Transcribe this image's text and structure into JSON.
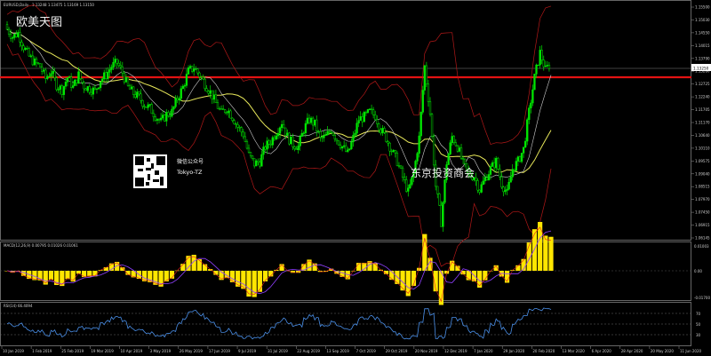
{
  "window": {
    "title": "EURUSD,Daily",
    "price_info": "1.13248 1.13475 1.13169 1.13150"
  },
  "overlay": {
    "title": "欧美天图",
    "watermark": "东京投资商会",
    "wechat_label": "微信公众号",
    "wechat_id": "Tokyo-TZ"
  },
  "price_axis": {
    "labels": [
      "1.15500",
      "1.15030",
      "1.14550",
      "1.14015",
      "1.13790",
      "1.13280",
      "1.12725",
      "1.12240",
      "1.11705",
      "1.11170",
      "1.10640",
      "1.10110",
      "1.09575",
      "1.09040",
      "1.08515",
      "1.07970",
      "1.07450",
      "1.06915",
      "1.06145"
    ],
    "current_price": "1.13250"
  },
  "macd_panel": {
    "label": "MACD(12,26,9) 0.00795 0.01026 0.01061",
    "axis_labels": [
      "0.01003",
      "0.00",
      "-0.01700"
    ]
  },
  "rsi_panel": {
    "label": "RSI(14) 66.4094",
    "axis_labels": [
      "70",
      "50",
      "30"
    ]
  },
  "time_axis": {
    "labels": [
      "10 Jan 2019",
      "1 Feb 2019",
      "25 Feb 2019",
      "19 Mar 2019",
      "10 Apr 2019",
      "3 May 2019",
      "26 May 2019",
      "17 Jun 2019",
      "9 Jul 2019",
      "31 Jul 2019",
      "22 Aug 2019",
      "13 Sep 2019",
      "7 Oct 2019",
      "29 Oct 2019",
      "20 Nov 2019",
      "12 Dec 2019",
      "7 Jan 2020",
      "29 Jan 2020",
      "20 Feb 2020",
      "13 Mar 2020",
      "6 Apr 2020",
      "28 Apr 2020",
      "20 May 2020",
      "11 Jun 2020"
    ]
  },
  "colors": {
    "background": "#000000",
    "bull_candle": "#00e600",
    "ma_yellow": "#e8e85a",
    "band_red": "#b01818",
    "ma_white": "#cfcfcf",
    "level_line": "#e31212",
    "macd_hist": "#ffe600",
    "macd_signal": "#9040ff",
    "macd_line": "#e02020",
    "rsi_line": "#4a8fe8"
  },
  "chart_data": {
    "type": "candlestick",
    "series": [
      {
        "name": "EURUSD,Daily",
        "values": [
          1.146,
          1.143,
          1.1445,
          1.139,
          1.135,
          1.1325,
          1.131,
          1.126,
          1.129,
          1.1235,
          1.1215,
          1.1265,
          1.1225,
          1.1275,
          1.123,
          1.122,
          1.121,
          1.1255,
          1.1275,
          1.131,
          1.1325,
          1.1285,
          1.1225,
          1.12,
          1.1185,
          1.1155,
          1.114,
          1.111,
          1.1085,
          1.1115,
          1.1125,
          1.118,
          1.1225,
          1.129,
          1.1305,
          1.1275,
          1.124,
          1.1205,
          1.116,
          1.112,
          1.114,
          1.1105,
          1.1065,
          1.1035,
          1.095,
          1.0915,
          1.0925,
          1.0985,
          1.1005,
          1.1045,
          1.1085,
          1.1025,
          1.0995,
          1.0985,
          1.1055,
          1.1095,
          1.1075,
          1.1015,
          1.1025,
          1.1055,
          1.1015,
          1.0985,
          1.0955,
          1.102,
          1.1095,
          1.1105,
          1.1125,
          1.111,
          1.1055,
          1.102,
          1.097,
          1.0925,
          1.086,
          1.08,
          1.0875,
          1.102,
          1.131,
          1.112,
          1.0825,
          1.068,
          1.092,
          1.1025,
          1.0985,
          1.0915,
          1.087,
          1.0865,
          1.081,
          1.0855,
          1.0895,
          1.0925,
          1.0835,
          1.0795,
          1.0895,
          1.0925,
          1.0975,
          1.1125,
          1.1265,
          1.1365,
          1.1295,
          1.1325
        ]
      }
    ]
  }
}
